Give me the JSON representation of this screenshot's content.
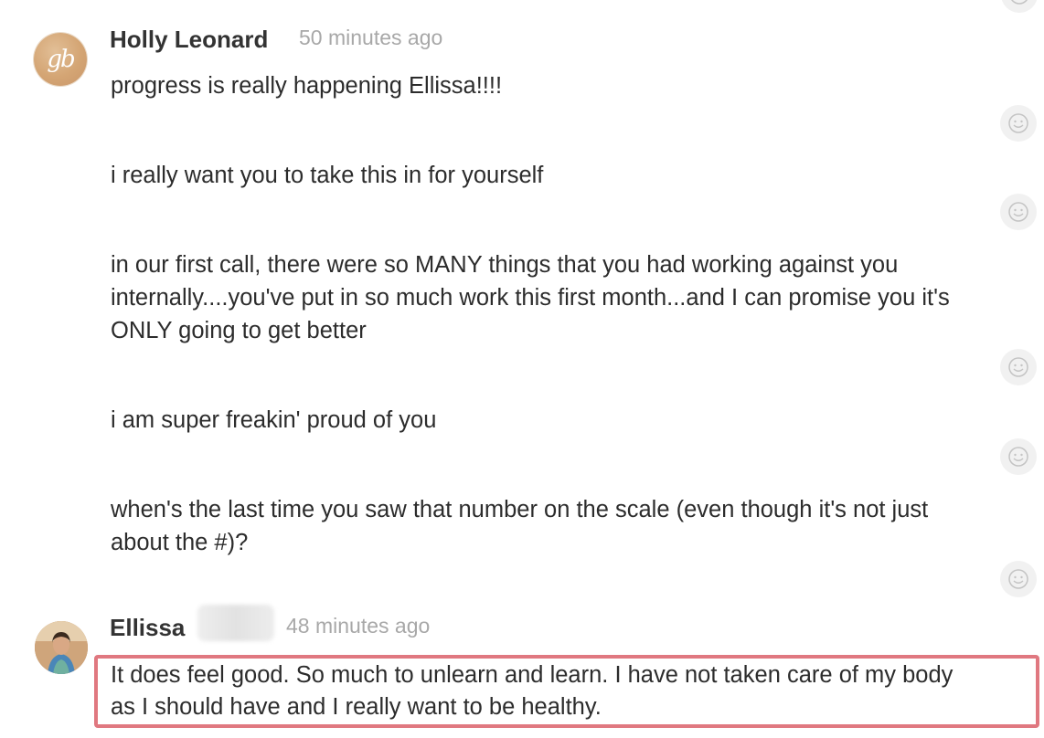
{
  "messages": [
    {
      "author": "Holly Leonard",
      "timestamp": "50 minutes ago",
      "avatar_initials": "gb",
      "lines": [
        "progress is really happening Ellissa!!!!",
        "i really want you to take this in for yourself",
        "in our first call, there were so MANY things that you had working against you",
        "internally....you've put in so much work this first month...and I can promise you it's",
        "ONLY going to get better",
        "i am super freakin' proud of you",
        "when's the last time you saw that number on the scale (even though it's not just",
        "about the #)?"
      ]
    },
    {
      "author": "Ellissa",
      "timestamp": "48 minutes ago",
      "lines": [
        "It does feel good. So much to unlearn and learn. I have not taken care of my body",
        "as I should have and I really want to be healthy."
      ]
    }
  ],
  "colors": {
    "highlight_border": "#e07880",
    "timestamp": "#a8a8a8",
    "reaction_bg": "#f1f1f1"
  },
  "icons": {
    "reaction": "smiley-icon"
  }
}
